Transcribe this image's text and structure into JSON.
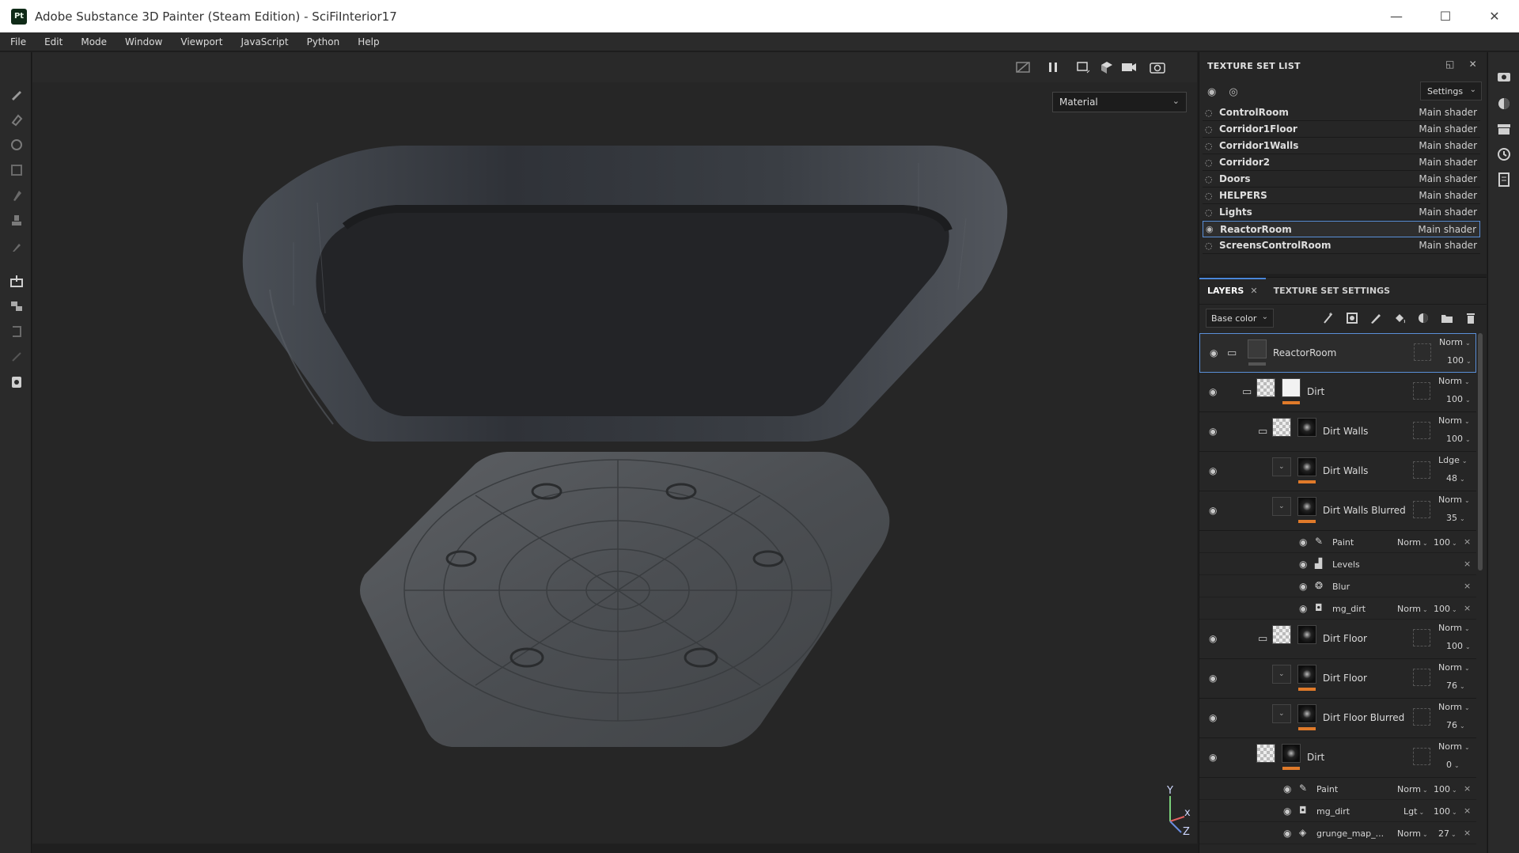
{
  "window": {
    "app_icon_text": "Pt",
    "title": "Adobe Substance 3D Painter (Steam Edition) - SciFiInterior17",
    "minimize": "—",
    "maximize": "☐",
    "close": "✕"
  },
  "menu": [
    "File",
    "Edit",
    "Mode",
    "Window",
    "Viewport",
    "JavaScript",
    "Python",
    "Help"
  ],
  "viewport": {
    "display_mode": "Material",
    "axis": {
      "y": "Y",
      "x": "x",
      "z": "Z"
    }
  },
  "texture_set_list": {
    "title": "TEXTURE SET LIST",
    "settings_label": "Settings",
    "items": [
      {
        "name": "ControlRoom",
        "shader": "Main shader",
        "selected": false
      },
      {
        "name": "Corridor1Floor",
        "shader": "Main shader",
        "selected": false
      },
      {
        "name": "Corridor1Walls",
        "shader": "Main shader",
        "selected": false
      },
      {
        "name": "Corridor2",
        "shader": "Main shader",
        "selected": false
      },
      {
        "name": "Doors",
        "shader": "Main shader",
        "selected": false
      },
      {
        "name": "HELPERS",
        "shader": "Main shader",
        "selected": false
      },
      {
        "name": "Lights",
        "shader": "Main shader",
        "selected": false
      },
      {
        "name": "ReactorRoom",
        "shader": "Main shader",
        "selected": true
      },
      {
        "name": "ScreensControlRoom",
        "shader": "Main shader",
        "selected": false
      }
    ]
  },
  "layers_panel": {
    "tab_layers": "LAYERS",
    "tab_close": "✕",
    "tab_texture_set_settings": "TEXTURE SET SETTINGS",
    "channel": "Base color",
    "layers": [
      {
        "name": "ReactorRoom",
        "mode": "Norm",
        "opacity": "100"
      },
      {
        "name": "Dirt",
        "mode": "Norm",
        "opacity": "100"
      },
      {
        "name": "Dirt Walls",
        "mode": "Norm",
        "opacity": "100"
      },
      {
        "name": "Dirt Walls",
        "mode": "Ldge",
        "opacity": "48"
      },
      {
        "name": "Dirt Walls Blurred",
        "mode": "Norm",
        "opacity": "35"
      },
      {
        "name": "Dirt Floor",
        "mode": "Norm",
        "opacity": "100"
      },
      {
        "name": "Dirt Floor",
        "mode": "Norm",
        "opacity": "76"
      },
      {
        "name": "Dirt Floor Blurred",
        "mode": "Norm",
        "opacity": "76"
      },
      {
        "name": "Dirt",
        "mode": "Norm",
        "opacity": "0"
      }
    ],
    "effects_a": [
      {
        "name": "Paint",
        "mode": "Norm",
        "value": "100"
      },
      {
        "name": "Levels",
        "mode": "",
        "value": ""
      },
      {
        "name": "Blur",
        "mode": "",
        "value": ""
      },
      {
        "name": "mg_dirt",
        "mode": "Norm",
        "value": "100"
      }
    ],
    "effects_b": [
      {
        "name": "Paint",
        "mode": "Norm",
        "value": "100"
      },
      {
        "name": "mg_dirt",
        "mode": "Lgt",
        "value": "100"
      },
      {
        "name": "grunge_map_...",
        "mode": "Norm",
        "value": "27"
      }
    ]
  },
  "colors": {
    "accent_blue": "#4a86d8",
    "mask_orange": "#e07a2a",
    "panel_bg": "#262626"
  }
}
